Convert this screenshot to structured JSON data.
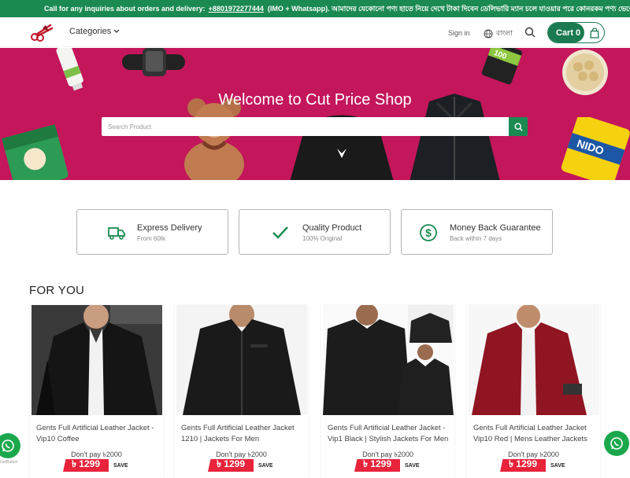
{
  "topbar": {
    "prefix": "Call for any inquiries about orders and delivery:",
    "phone": "+8801972277444",
    "suffix": "(IMO + Whatsapp). আমাদের যেকোনো পণ্য হাতে নিয়ে দেখে টাকা দিবেন ডেলিভারি ম্যান চলে যাওয়ার পরে কোনরকম পণ্য ভেঙে গেছে নষ্ট থাকে"
  },
  "header": {
    "logo_icon": "scissors-logo-icon",
    "categories_label": "Categories",
    "signin_label": "Sign in",
    "language_label": "বাংলা",
    "cart_label": "Cart 0"
  },
  "hero": {
    "title": "Welcome to Cut Price Shop",
    "search_placeholder": "Search Product",
    "background_color": "#c3165b"
  },
  "features": [
    {
      "title": "Express Delivery",
      "subtitle": "From 60tk",
      "icon": "truck-icon"
    },
    {
      "title": "Quality Product",
      "subtitle": "100% Original",
      "icon": "check-icon"
    },
    {
      "title": "Money Back Guarantee",
      "subtitle": "Back within 7 days",
      "icon": "dollar-circle-icon"
    }
  ],
  "section_title": "FOR YOU",
  "products": [
    {
      "title": "Gents Full Artificial Leather Jacket - Vip10 Coffee",
      "dont_pay": "Don't pay ৳2000",
      "price": "৳ 1299",
      "save": "SAVE"
    },
    {
      "title": "Gents Full Artificial Leather Jacket 1210 | Jackets For Men",
      "dont_pay": "Don't pay ৳2000",
      "price": "৳ 1299",
      "save": "SAVE"
    },
    {
      "title": "Gents Full Artificial Leather Jacket - Vip1 Black | Stylish Jackets For Men",
      "dont_pay": "Don't pay ৳2000",
      "price": "৳ 1299",
      "save": "SAVE"
    },
    {
      "title": "Gents Full Artificial Leather Jacket Vip10 Red | Mens Leather Jackets",
      "dont_pay": "Don't pay ৳2000",
      "price": "৳ 1299",
      "save": "SAVE"
    }
  ],
  "whatsapp_caption": "GetButton",
  "colors": {
    "brand_green": "#1b8a52",
    "hero_pink": "#c3165b",
    "price_red": "#e8233a"
  }
}
